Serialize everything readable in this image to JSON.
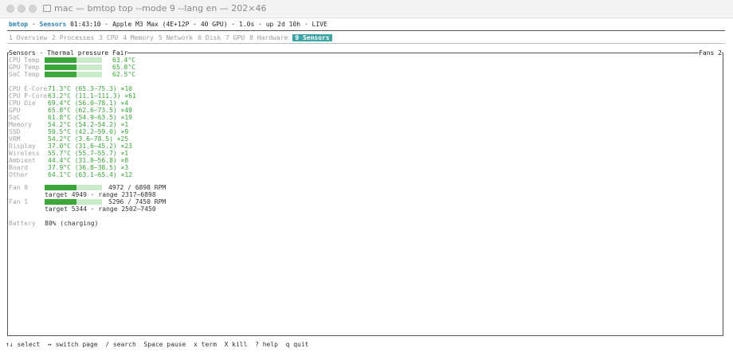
{
  "window": {
    "title": "mac — bmtop top --mode 9 --lang en — 202×46"
  },
  "header": {
    "brand": "bmtop",
    "sep": " · ",
    "page": "Sensors",
    "rest": " 01:43:10 · Apple M3 Max (4E+12P · 40 GPU) · 1.0s · up 2d 10h · LIVE"
  },
  "tabs": [
    {
      "label": "1 Overview"
    },
    {
      "label": "2 Processes"
    },
    {
      "label": "3 CPU"
    },
    {
      "label": "4 Memory"
    },
    {
      "label": "5 Network"
    },
    {
      "label": "6 Disk"
    },
    {
      "label": "7 GPU"
    },
    {
      "label": "8 Hardware"
    },
    {
      "label": "9 Sensors",
      "active": true
    }
  ],
  "panel": {
    "title": "Sensors · Thermal pressure Fair",
    "right_title": "Fans 2"
  },
  "temps": [
    {
      "label": "CPU Temp",
      "value": "63.4°C",
      "fill": 0.56
    },
    {
      "label": "GPU Temp",
      "value": "65.8°C",
      "fill": 0.56
    },
    {
      "label": "SoC Temp",
      "value": "62.5°C",
      "fill": 0.56
    }
  ],
  "sensors": [
    {
      "label": "CPU E-Core",
      "value": "71.3°C (65.3–75.3) ×10"
    },
    {
      "label": "CPU P-Core",
      "value": "63.2°C (11.1–111.3) ×61"
    },
    {
      "label": "CPU Die",
      "value": "69.4°C (56.0–78.1) ×4"
    },
    {
      "label": "GPU",
      "value": "65.8°C (62.6–73.5) ×49"
    },
    {
      "label": "SoC",
      "value": "61.8°C (54.9–63.5) ×19"
    },
    {
      "label": "Memory",
      "value": "54.2°C (54.2–54.2) ×1"
    },
    {
      "label": "SSD",
      "value": "50.5°C (42.2–59.0) ×9"
    },
    {
      "label": "VRM",
      "value": "54.2°C (3.6–78.5) ×25"
    },
    {
      "label": "Display",
      "value": "37.0°C (31.6–45.2) ×23"
    },
    {
      "label": "Wireless",
      "value": "55.7°C (55.7–55.7) ×1"
    },
    {
      "label": "Ambient",
      "value": "44.4°C (31.8–56.8) ×8"
    },
    {
      "label": "Board",
      "value": "37.9°C (36.8–38.5) ×3"
    },
    {
      "label": "Other",
      "value": "64.1°C (63.1–65.4) ×12"
    }
  ],
  "fans": [
    {
      "label": "Fan 0",
      "rpm": "4972 / 6898 RPM",
      "detail": "target 4949 · range 2317–6898",
      "fill": 0.56
    },
    {
      "label": "Fan 1",
      "rpm": "5296 / 7450 RPM",
      "detail": "target 5344 · range 2502–7450",
      "fill": 0.56
    }
  ],
  "battery": {
    "label": "Battery",
    "value": "80% (charging)"
  },
  "footer": "↑↓ select  ↔ switch page  / search  Space pause  x term  X kill  ? help  q quit"
}
